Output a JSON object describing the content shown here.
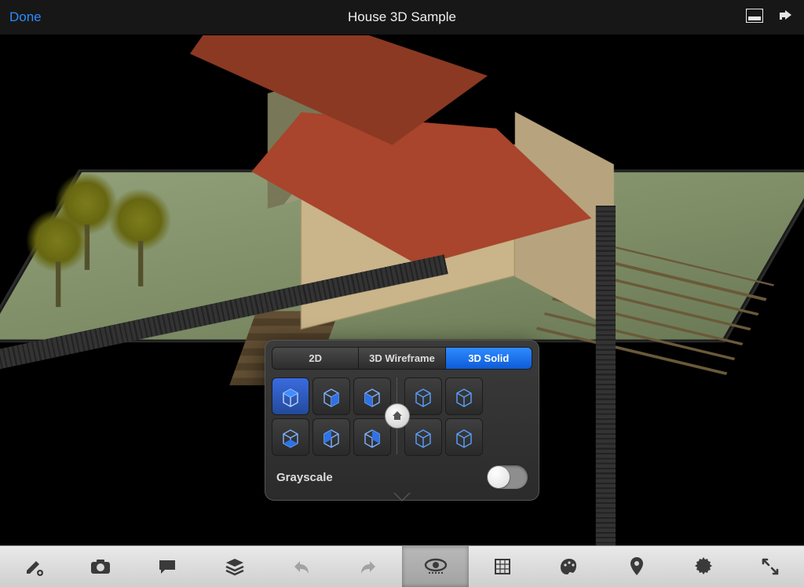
{
  "topbar": {
    "done": "Done",
    "title": "House 3D Sample"
  },
  "popover": {
    "segments": {
      "s0": "2D",
      "s1": "3D Wireframe",
      "s2": "3D Solid"
    },
    "active_segment": 2,
    "grayscale_label": "Grayscale",
    "grayscale_on": false,
    "iso_views": {
      "left_count": 6,
      "right_count": 4,
      "selected_left_index": 0
    }
  },
  "toolbar": {
    "active_index": 5,
    "items": [
      "edit",
      "camera",
      "comment",
      "layers",
      "undo",
      "redo",
      "view-mode",
      "grid",
      "palette",
      "marker",
      "settings",
      "fullscreen"
    ]
  }
}
